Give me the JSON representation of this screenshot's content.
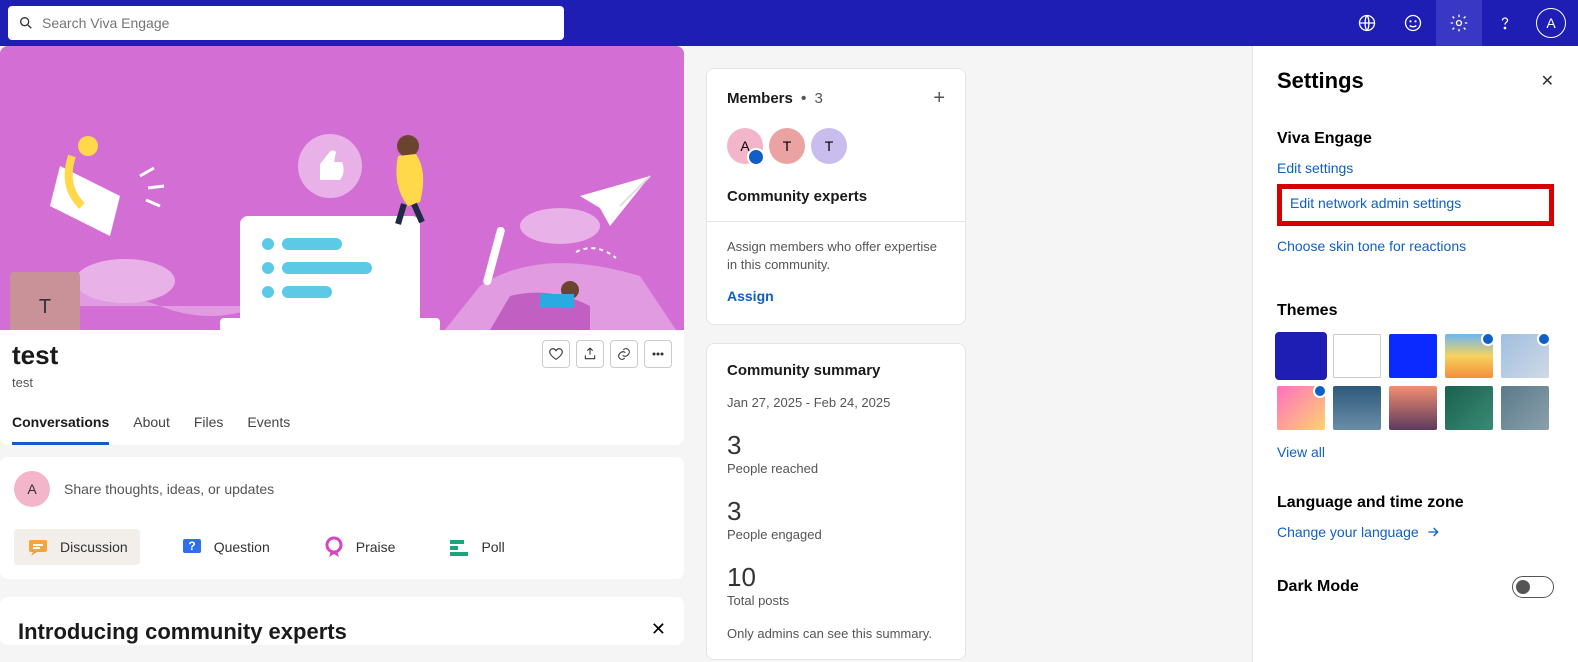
{
  "search": {
    "placeholder": "Search Viva Engage"
  },
  "user_avatar_letter": "A",
  "community": {
    "avatar_letter": "T",
    "title": "test",
    "subtitle": "test",
    "tabs": [
      "Conversations",
      "About",
      "Files",
      "Events"
    ],
    "composer_placeholder": "Share thoughts, ideas, or updates",
    "composer_avatar_letter": "A",
    "options": {
      "discussion": "Discussion",
      "question": "Question",
      "praise": "Praise",
      "poll": "Poll"
    },
    "intro_title": "Introducing community experts"
  },
  "members_card": {
    "title": "Members",
    "count": "3",
    "avatars": [
      {
        "letter": "A",
        "bg": "#f2b5ca",
        "badge": true
      },
      {
        "letter": "T",
        "bg": "#eaa2a2",
        "badge": false
      },
      {
        "letter": "T",
        "bg": "#c8bdec",
        "badge": false
      }
    ],
    "experts_title": "Community experts",
    "experts_desc": "Assign members who offer expertise in this community.",
    "assign_label": "Assign"
  },
  "summary_card": {
    "title": "Community summary",
    "date_range": "Jan 27, 2025 - Feb 24, 2025",
    "stats": [
      {
        "num": "3",
        "label": "People reached"
      },
      {
        "num": "3",
        "label": "People engaged"
      },
      {
        "num": "10",
        "label": "Total posts"
      }
    ],
    "admin_note": "Only admins can see this summary."
  },
  "settings": {
    "title": "Settings",
    "section1": "Viva Engage",
    "links": {
      "edit_settings": "Edit settings",
      "edit_network": "Edit network admin settings",
      "skin_tone": "Choose skin tone for reactions"
    },
    "themes_title": "Themes",
    "view_all": "View all",
    "language_title": "Language and time zone",
    "change_language": "Change your language",
    "dark_mode": "Dark Mode"
  }
}
